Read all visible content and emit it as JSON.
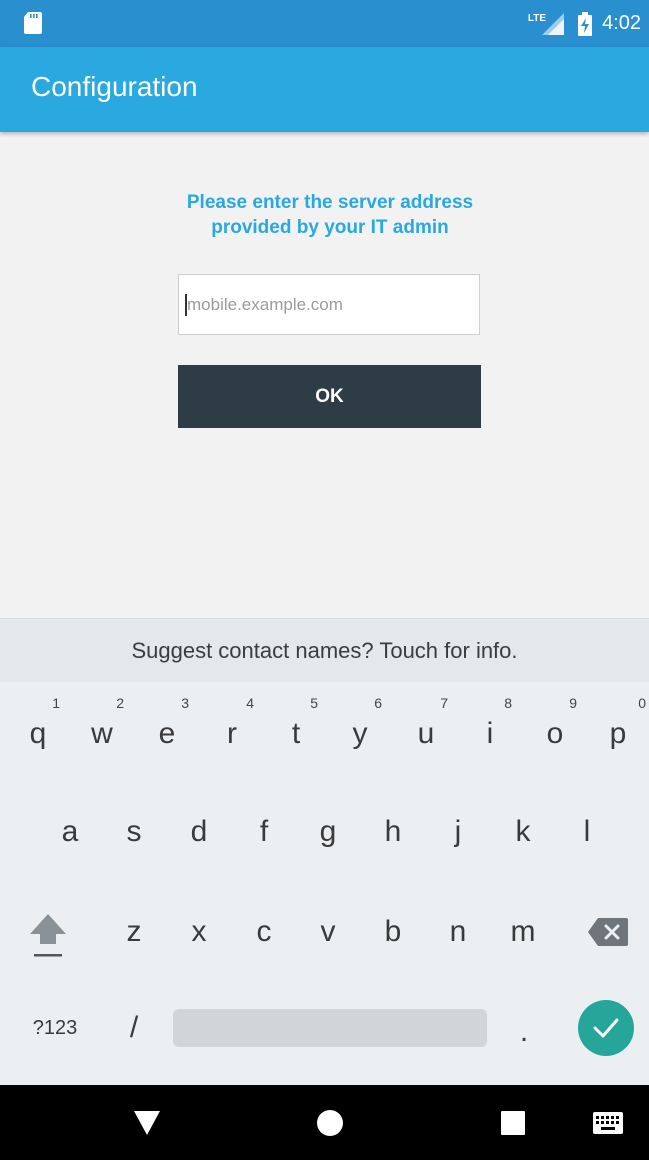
{
  "status_bar": {
    "network": "LTE",
    "time": "4:02"
  },
  "app_bar": {
    "title": "Configuration"
  },
  "form": {
    "prompt": "Please enter the server address provided by your IT admin",
    "server_field": {
      "value": "",
      "placeholder": "mobile.example.com"
    },
    "ok_label": "OK"
  },
  "keyboard": {
    "suggestion_text": "Suggest contact names? Touch for info.",
    "row1": [
      {
        "key": "q",
        "hint": "1"
      },
      {
        "key": "w",
        "hint": "2"
      },
      {
        "key": "e",
        "hint": "3"
      },
      {
        "key": "r",
        "hint": "4"
      },
      {
        "key": "t",
        "hint": "5"
      },
      {
        "key": "y",
        "hint": "6"
      },
      {
        "key": "u",
        "hint": "7"
      },
      {
        "key": "i",
        "hint": "8"
      },
      {
        "key": "o",
        "hint": "9"
      },
      {
        "key": "p",
        "hint": "0"
      }
    ],
    "row2": [
      "a",
      "s",
      "d",
      "f",
      "g",
      "h",
      "j",
      "k",
      "l"
    ],
    "row3": [
      "z",
      "x",
      "c",
      "v",
      "b",
      "n",
      "m"
    ],
    "symbols_label": "?123",
    "slash_label": "/",
    "period_label": ".",
    "colors": {
      "accent": "#26a69a",
      "brand": "#29a9e0"
    }
  }
}
